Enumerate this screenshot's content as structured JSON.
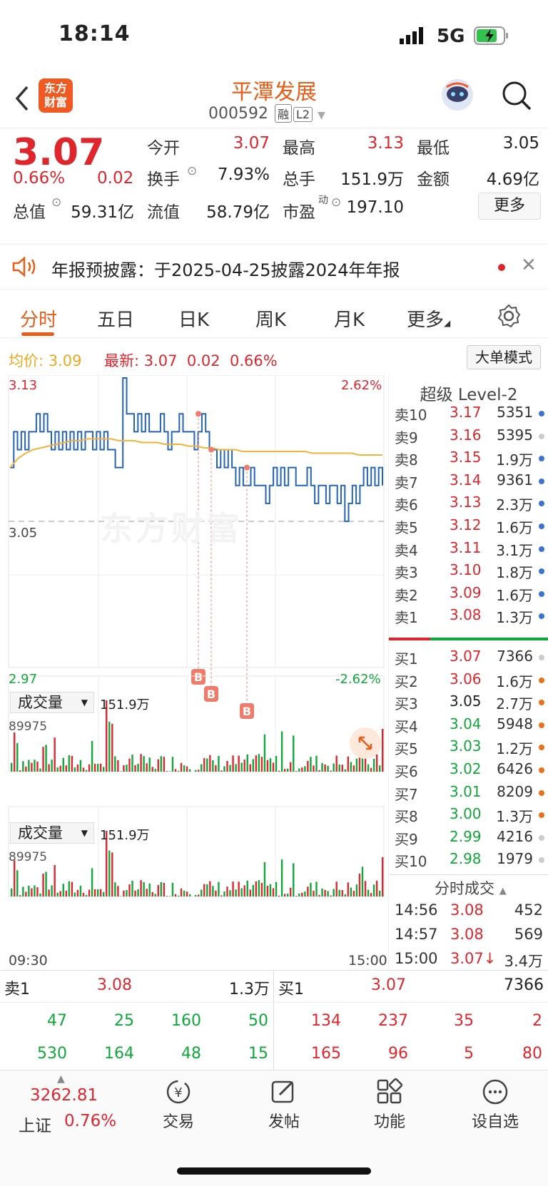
{
  "status_bar": {
    "time": "18:14",
    "network": "5G"
  },
  "header": {
    "logo_text_1": "东方",
    "logo_text_2": "财富",
    "title": "平潭发展",
    "code": "000592",
    "tag_margin": "融",
    "tag_level": "L2"
  },
  "quote": {
    "price": "3.07",
    "change_pct": "0.66%",
    "change_abs": "0.02",
    "open_label": "今开",
    "open": "3.07",
    "high_label": "最高",
    "high": "3.13",
    "low_label": "最低",
    "low": "3.05",
    "turnover_label": "换手",
    "turnover": "7.93%",
    "volume_label": "总手",
    "volume": "151.9万",
    "amount_label": "金额",
    "amount": "4.69亿",
    "mktcap_label": "总值",
    "mktcap": "59.31亿",
    "float_label": "流值",
    "float": "58.79亿",
    "pe_label": "市盈",
    "pe_sup": "动",
    "pe": "197.10",
    "more_button": "更多"
  },
  "notice": {
    "text": "年报预披露：于2025-04-25披露2024年年报"
  },
  "tabs": [
    {
      "label": "分时",
      "active": true
    },
    {
      "label": "五日"
    },
    {
      "label": "日K"
    },
    {
      "label": "周K"
    },
    {
      "label": "月K"
    },
    {
      "label": "更多"
    }
  ],
  "info_bar": {
    "avg_label": "均价:",
    "avg": "3.09",
    "latest_label": "最新:",
    "latest": "3.07",
    "chg": "0.02",
    "chg_pct": "0.66%",
    "mode_button": "大单模式"
  },
  "chart_data": {
    "type": "line",
    "y_top": "3.13",
    "y_mid": "3.05",
    "y_bottom": "2.97",
    "pct_top": "2.62%",
    "pct_bottom": "-2.62%",
    "ylim": [
      2.97,
      3.13
    ],
    "x_start": "09:30",
    "x_end": "15:00",
    "watermark": "东方财富",
    "price_series_note": "intraday price oscillating between 3.05 and 3.13",
    "price": [
      3.08,
      3.1,
      3.09,
      3.1,
      3.09,
      3.1,
      3.1,
      3.11,
      3.1,
      3.11,
      3.1,
      3.09,
      3.1,
      3.09,
      3.1,
      3.09,
      3.1,
      3.09,
      3.1,
      3.09,
      3.1,
      3.1,
      3.09,
      3.1,
      3.09,
      3.1,
      3.09,
      3.09,
      3.08,
      3.08,
      3.13,
      3.11,
      3.11,
      3.1,
      3.11,
      3.1,
      3.11,
      3.1,
      3.1,
      3.1,
      3.11,
      3.1,
      3.09,
      3.1,
      3.1,
      3.11,
      3.1,
      3.1,
      3.1,
      3.09,
      3.1,
      3.11,
      3.1,
      3.09,
      3.09,
      3.08,
      3.09,
      3.08,
      3.09,
      3.08,
      3.07,
      3.08,
      3.07,
      3.07,
      3.08,
      3.07,
      3.07,
      3.07,
      3.06,
      3.07,
      3.08,
      3.07,
      3.08,
      3.07,
      3.08,
      3.08,
      3.07,
      3.07,
      3.07,
      3.08,
      3.07,
      3.06,
      3.07,
      3.07,
      3.06,
      3.07,
      3.07,
      3.06,
      3.07,
      3.05,
      3.06,
      3.07,
      3.06,
      3.07,
      3.08,
      3.07,
      3.08,
      3.07,
      3.08,
      3.07
    ],
    "avg": [
      3.08,
      3.085,
      3.088,
      3.09,
      3.091,
      3.092,
      3.093,
      3.094,
      3.095,
      3.095,
      3.096,
      3.096,
      3.096,
      3.096,
      3.095,
      3.095,
      3.095,
      3.094,
      3.094,
      3.094,
      3.093,
      3.093,
      3.093,
      3.092,
      3.092,
      3.091,
      3.091,
      3.09,
      3.09,
      3.09,
      3.089,
      3.089,
      3.089,
      3.089,
      3.089,
      3.089,
      3.089,
      3.089,
      3.089,
      3.088,
      3.088,
      3.088,
      3.088,
      3.088,
      3.088,
      3.087,
      3.087,
      3.087,
      3.087
    ],
    "trade_markers": [
      "B",
      "B",
      "B"
    ],
    "volume_label": "成交量",
    "volume_total": "151.9万",
    "volume_max": "89975"
  },
  "orderbook": {
    "title": "超级 Level-2",
    "asks": [
      {
        "label": "卖10",
        "price": "3.17",
        "vol": "5351",
        "dot": "#3a72d6"
      },
      {
        "label": "卖9",
        "price": "3.16",
        "vol": "5395",
        "dot": "#cccccc"
      },
      {
        "label": "卖8",
        "price": "3.15",
        "vol": "1.9万",
        "dot": "#3a72d6"
      },
      {
        "label": "卖7",
        "price": "3.14",
        "vol": "9361",
        "dot": "#3a72d6"
      },
      {
        "label": "卖6",
        "price": "3.13",
        "vol": "2.3万",
        "dot": "#3a72d6"
      },
      {
        "label": "卖5",
        "price": "3.12",
        "vol": "1.6万",
        "dot": "#3a72d6"
      },
      {
        "label": "卖4",
        "price": "3.11",
        "vol": "3.1万",
        "dot": "#3a72d6"
      },
      {
        "label": "卖3",
        "price": "3.10",
        "vol": "1.8万",
        "dot": "#3a72d6"
      },
      {
        "label": "卖2",
        "price": "3.09",
        "vol": "1.6万",
        "dot": "#3a72d6"
      },
      {
        "label": "卖1",
        "price": "3.08",
        "vol": "1.3万",
        "dot": "#3a72d6"
      }
    ],
    "bids": [
      {
        "label": "买1",
        "price": "3.07",
        "vol": "7366",
        "dot": "#cccccc",
        "color": "red"
      },
      {
        "label": "买2",
        "price": "3.06",
        "vol": "1.6万",
        "dot": "#e8711c",
        "color": "red"
      },
      {
        "label": "买3",
        "price": "3.05",
        "vol": "2.7万",
        "dot": "#e8711c",
        "color": "black"
      },
      {
        "label": "买4",
        "price": "3.04",
        "vol": "5948",
        "dot": "#e8711c",
        "color": "green"
      },
      {
        "label": "买5",
        "price": "3.03",
        "vol": "1.2万",
        "dot": "#e8711c",
        "color": "green"
      },
      {
        "label": "买6",
        "price": "3.02",
        "vol": "6426",
        "dot": "#e8711c",
        "color": "green"
      },
      {
        "label": "买7",
        "price": "3.01",
        "vol": "8209",
        "dot": "#e8711c",
        "color": "green"
      },
      {
        "label": "买8",
        "price": "3.00",
        "vol": "1.3万",
        "dot": "#e8711c",
        "color": "green"
      },
      {
        "label": "买9",
        "price": "2.99",
        "vol": "4216",
        "dot": "#cccccc",
        "color": "green"
      },
      {
        "label": "买10",
        "price": "2.98",
        "vol": "1979",
        "dot": "#cccccc",
        "color": "green"
      }
    ],
    "ticks_title": "分时成交",
    "ticks": [
      {
        "time": "14:56",
        "price": "3.08",
        "vol": "452"
      },
      {
        "time": "14:57",
        "price": "3.08",
        "vol": "569"
      },
      {
        "time": "15:00",
        "price": "3.07↓",
        "vol": "3.4万"
      }
    ]
  },
  "queue": {
    "sell_label": "卖1",
    "sell_price": "3.08",
    "sell_vol": "1.3万",
    "buy_label": "买1",
    "buy_price": "3.07",
    "buy_vol": "7366",
    "sell_row1": [
      "47",
      "25",
      "160",
      "50"
    ],
    "sell_row2": [
      "530",
      "164",
      "48",
      "15"
    ],
    "buy_row1": [
      "134",
      "237",
      "35",
      "2"
    ],
    "buy_row2": [
      "165",
      "96",
      "5",
      "80"
    ]
  },
  "tabbar": {
    "index_value": "3262.81",
    "index_name": "上证",
    "index_pct": "0.76%",
    "items": [
      "交易",
      "发帖",
      "功能",
      "设自选"
    ]
  }
}
